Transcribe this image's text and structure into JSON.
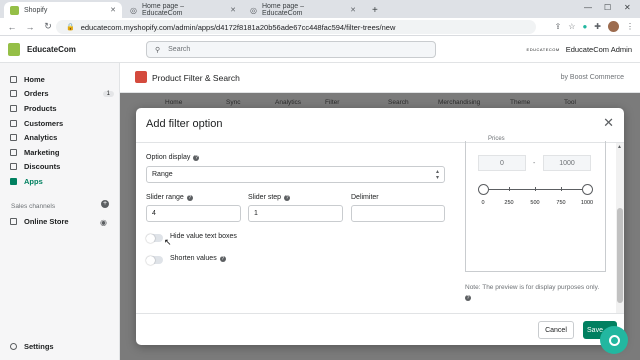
{
  "browser": {
    "tabs": [
      {
        "title": "Shopify",
        "color": "#95bf47"
      },
      {
        "title": "Home page – EducateCom",
        "color": "#5f6368"
      },
      {
        "title": "Home page – EducateCom",
        "color": "#5f6368"
      }
    ],
    "new_tab": "+",
    "url": "educatecom.myshopify.com/admin/apps/d4172f8181a20b56ade67cc448fac594/filter-trees/new"
  },
  "topbar": {
    "store_name": "EducateCom",
    "search_placeholder": "Search",
    "admin_brand": "EDUCATECOM",
    "admin_name": "EducateCom Admin"
  },
  "sidebar": {
    "items": [
      {
        "label": "Home"
      },
      {
        "label": "Orders",
        "badge": "1"
      },
      {
        "label": "Products"
      },
      {
        "label": "Customers"
      },
      {
        "label": "Analytics"
      },
      {
        "label": "Marketing"
      },
      {
        "label": "Discounts"
      },
      {
        "label": "Apps",
        "active": true
      }
    ],
    "sales_channels_label": "Sales channels",
    "online_store": "Online Store",
    "settings": "Settings"
  },
  "app": {
    "title": "Product Filter & Search",
    "byline": "by Boost Commerce",
    "nav": [
      "Home",
      "Sync",
      "Analytics",
      "Filter",
      "Search",
      "Merchandising",
      "Theme",
      "Tool"
    ]
  },
  "modal": {
    "title": "Add filter option",
    "option_display_label": "Option display",
    "option_display_value": "Range",
    "slider_range_label": "Slider range",
    "slider_range_value": "4",
    "slider_step_label": "Slider step",
    "slider_step_value": "1",
    "delimiter_label": "Delimiter",
    "delimiter_value": "",
    "hide_value_label": "Hide value text boxes",
    "shorten_values_label": "Shorten values",
    "preview": {
      "title": "Prices",
      "min": "0",
      "max": "1000",
      "separator": "-",
      "ticks": [
        "0",
        "250",
        "500",
        "750",
        "1000"
      ]
    },
    "note": "Note: The preview is for display purposes only.",
    "cancel_label": "Cancel",
    "save_label": "Save"
  },
  "colors": {
    "accent": "#008060",
    "shopify_green": "#95bf47",
    "app_red": "#d44a3d",
    "chat": "#22b7a0"
  }
}
